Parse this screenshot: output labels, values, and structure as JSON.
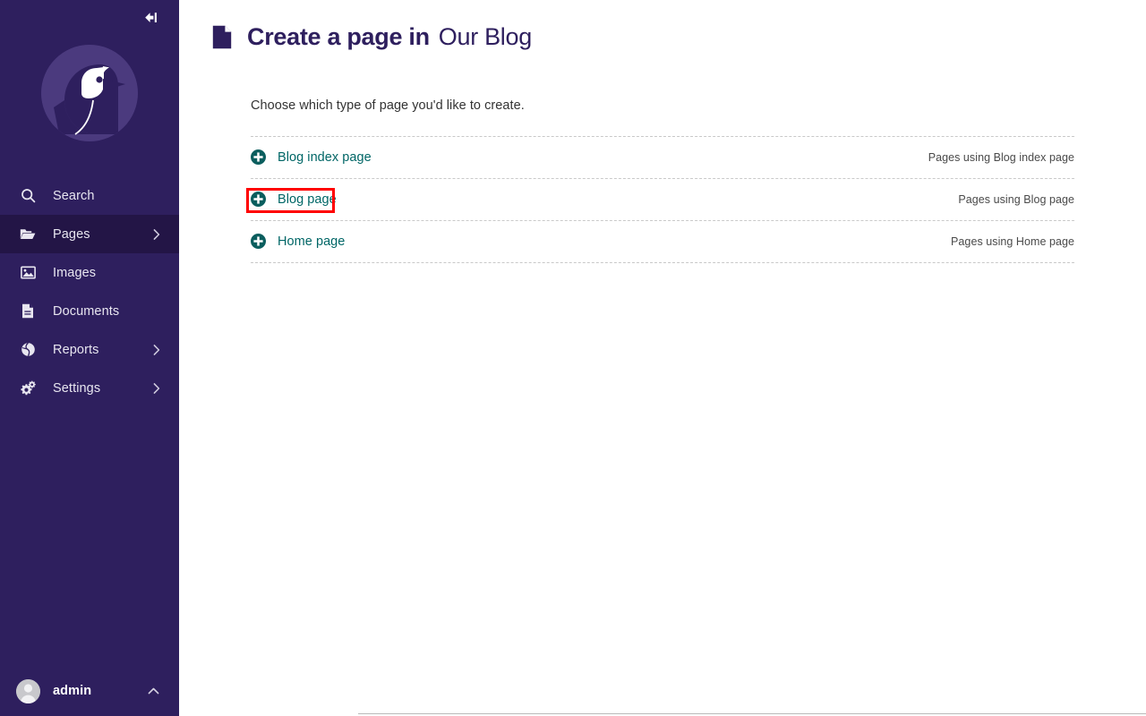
{
  "sidebar": {
    "collapse_icon": "collapse-left-icon",
    "logo": "wagtail-bird-logo",
    "items": [
      {
        "label": "Search",
        "icon": "search-icon",
        "active": false,
        "chevron": false
      },
      {
        "label": "Pages",
        "icon": "folder-open-icon",
        "active": true,
        "chevron": true
      },
      {
        "label": "Images",
        "icon": "image-icon",
        "active": false,
        "chevron": false
      },
      {
        "label": "Documents",
        "icon": "document-icon",
        "active": false,
        "chevron": false
      },
      {
        "label": "Reports",
        "icon": "globe-icon",
        "active": false,
        "chevron": true
      },
      {
        "label": "Settings",
        "icon": "gears-icon",
        "active": false,
        "chevron": true
      }
    ],
    "footer": {
      "username": "admin",
      "avatar_icon": "user-avatar-icon",
      "chevron_icon": "chevron-up-icon"
    }
  },
  "header": {
    "icon": "page-document-icon",
    "title_strong": "Create a page in",
    "title_parent": "Our Blog"
  },
  "main": {
    "intro": "Choose which type of page you'd like to create.",
    "page_types": [
      {
        "label": "Blog index page",
        "usage_label": "Pages using Blog index page",
        "icon": "plus-circle-icon",
        "highlighted": false
      },
      {
        "label": "Blog page",
        "usage_label": "Pages using Blog page",
        "icon": "plus-circle-icon",
        "highlighted": true
      },
      {
        "label": "Home page",
        "usage_label": "Pages using Home page",
        "icon": "plus-circle-icon",
        "highlighted": false
      }
    ]
  },
  "colors": {
    "sidebar_bg": "#2e1f5e",
    "sidebar_active": "#231546",
    "logo_circle": "#4b3a7e",
    "link_teal": "#006666",
    "heading": "#2e1f5e",
    "highlight": "#ff0000"
  }
}
